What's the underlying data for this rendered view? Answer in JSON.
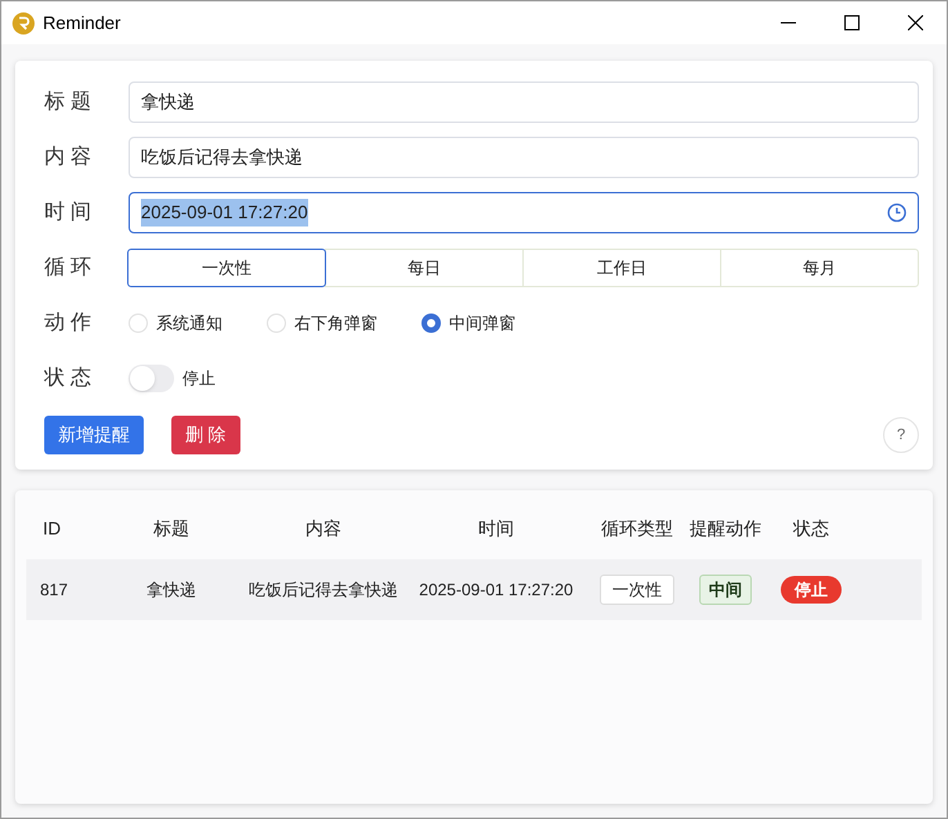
{
  "window": {
    "title": "Reminder"
  },
  "form": {
    "fields": [
      {
        "label": "标 题",
        "value": "拿快递",
        "focused": false,
        "text_selected": false
      },
      {
        "label": "内 容",
        "value": "吃饭后记得去拿快递",
        "focused": false,
        "text_selected": false
      },
      {
        "label": "时 间",
        "value": "2025-09-01 17:27:20",
        "focused": true,
        "text_selected": true
      }
    ],
    "repeat": {
      "label": "循 环",
      "options": [
        {
          "label": "一次性",
          "selected": true
        },
        {
          "label": "每日",
          "selected": false
        },
        {
          "label": "工作日",
          "selected": false
        },
        {
          "label": "每月",
          "selected": false
        }
      ]
    },
    "action": {
      "label": "动 作",
      "options": [
        {
          "label": "系统通知",
          "selected": false
        },
        {
          "label": "右下角弹窗",
          "selected": false
        },
        {
          "label": "中间弹窗",
          "selected": true
        }
      ]
    },
    "status": {
      "label": "状 态",
      "on": false,
      "text": "停止"
    },
    "buttons": [
      {
        "label": "新增提醒",
        "kind": "primary"
      },
      {
        "label": "删 除",
        "kind": "danger"
      }
    ],
    "help": "?"
  },
  "table": {
    "columns": [
      "ID",
      "标题",
      "内容",
      "时间",
      "循环类型",
      "提醒动作",
      "状态"
    ],
    "rows": [
      {
        "id": "817",
        "title": "拿快递",
        "content": "吃饭后记得去拿快递",
        "time": "2025-09-01 17:27:20",
        "repeat": "一次性",
        "action": "中间",
        "status": "停止"
      }
    ]
  }
}
